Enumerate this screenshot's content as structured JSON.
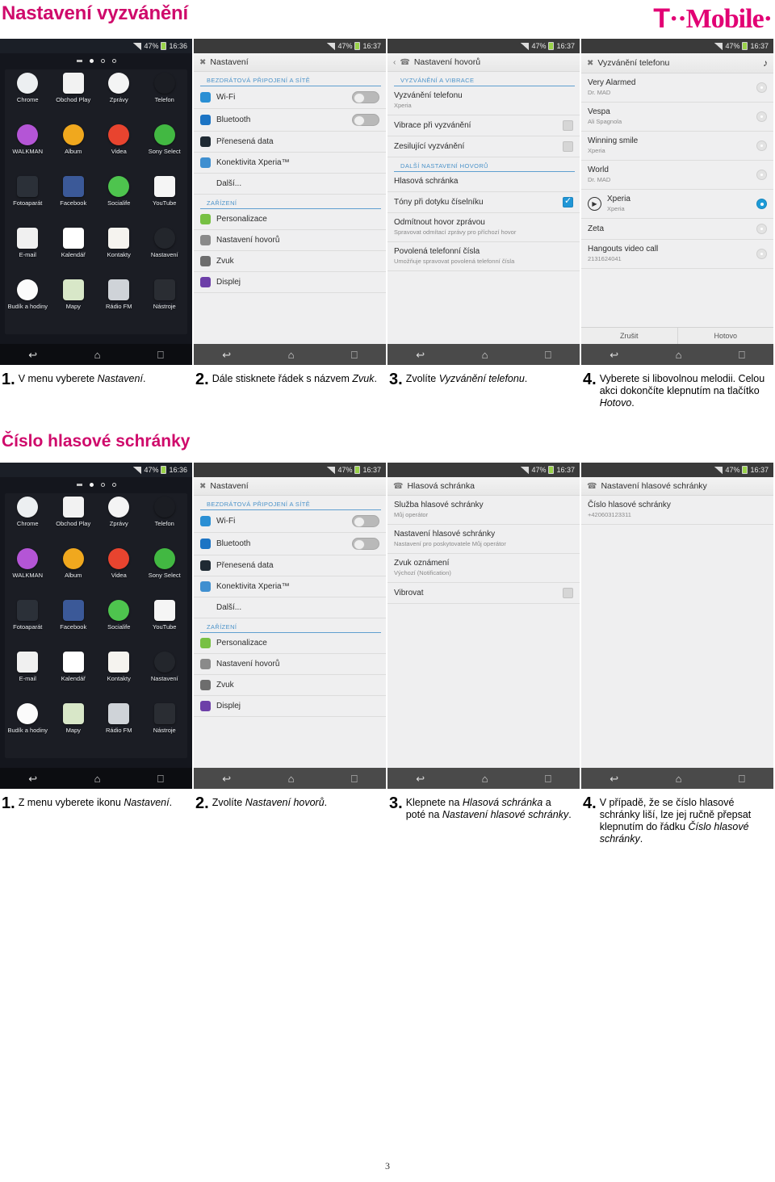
{
  "document": {
    "title": "Nastavení vyzvánění",
    "brand": "T-Mobile",
    "brand_t": "T",
    "brand_dots": "··",
    "brand_word": "Mobile",
    "brand_trailing_dot": "·",
    "page_number": "3",
    "section2_title": "Číslo hlasové schránky"
  },
  "statusbar": {
    "battery_pct": "47%",
    "time_1636": "16:36",
    "time_1637": "16:37"
  },
  "navbar": {
    "back": "back-icon",
    "home": "home-icon",
    "recents": "recents-icon"
  },
  "appdrawer": {
    "apps": [
      {
        "label": "Chrome",
        "color": "#eceff1"
      },
      {
        "label": "Obchod Play",
        "color": "#f2f2f2"
      },
      {
        "label": "Zprávy",
        "color": "#f4f4f4"
      },
      {
        "label": "Telefon",
        "color": "#1b1d23"
      },
      {
        "label": "WALKMAN",
        "color": "#b455d6"
      },
      {
        "label": "Album",
        "color": "#f0a81e"
      },
      {
        "label": "Videa",
        "color": "#e8442f"
      },
      {
        "label": "Sony Select",
        "color": "#42b842"
      },
      {
        "label": "Fotoaparát",
        "color": "#2b3038"
      },
      {
        "label": "Facebook",
        "color": "#3b5998"
      },
      {
        "label": "Socialife",
        "color": "#4ec44e"
      },
      {
        "label": "YouTube",
        "color": "#f5f5f5"
      },
      {
        "label": "E-mail",
        "color": "#f0f0f0"
      },
      {
        "label": "Kalendář",
        "color": "#ffffff"
      },
      {
        "label": "Kontakty",
        "color": "#f5f3ef"
      },
      {
        "label": "Nastavení",
        "color": "#23262c"
      },
      {
        "label": "Budík a hodiny",
        "color": "#fbfbfb"
      },
      {
        "label": "Mapy",
        "color": "#d8e7c8"
      },
      {
        "label": "Rádio FM",
        "color": "#cfd3d8"
      },
      {
        "label": "Nástroje",
        "color": "#2a2d33"
      }
    ]
  },
  "settings_screen": {
    "title": "Nastavení",
    "section_wireless": "BEZDRÁTOVÁ PŘIPOJENÍ A SÍTĚ",
    "section_device": "ZAŘÍZENÍ",
    "rows": [
      {
        "label": "Wi-Fi",
        "control": "toggle",
        "icon_color": "#2a8fd4"
      },
      {
        "label": "Bluetooth",
        "control": "toggle",
        "icon_color": "#1c74c4"
      },
      {
        "label": "Přenesená data",
        "control": "none",
        "icon_color": "#1f2a33"
      },
      {
        "label": "Konektivita Xperia™",
        "control": "none",
        "icon_color": "#3f8fd0"
      },
      {
        "label": "Další...",
        "control": "none",
        "icon_color": "transparent"
      }
    ],
    "rows2": [
      {
        "label": "Personalizace",
        "control": "none",
        "icon_color": "#77c043"
      },
      {
        "label": "Nastavení hovorů",
        "control": "none",
        "icon_color": "#8a8a8a"
      },
      {
        "label": "Zvuk",
        "control": "none",
        "icon_color": "#6d6d6d"
      },
      {
        "label": "Displej",
        "control": "none",
        "icon_color": "#6d3fa8"
      }
    ]
  },
  "call_settings_screen": {
    "title": "Nastavení hovorů",
    "section_ring": "VYZVÁNĚNÍ A VIBRACE",
    "section_more": "DALŠÍ NASTAVENÍ HOVORŮ",
    "rows_ring": [
      {
        "label": "Vyzvánění telefonu",
        "sub": "Xperia",
        "control": "none"
      },
      {
        "label": "Vibrace při vyzvánění",
        "sub": "",
        "control": "checkbox-off"
      },
      {
        "label": "Zesilující vyzvánění",
        "sub": "",
        "control": "checkbox-off"
      }
    ],
    "rows_more": [
      {
        "label": "Hlasová schránka",
        "sub": "",
        "control": "none"
      },
      {
        "label": "Tóny při dotyku číselníku",
        "sub": "",
        "control": "checkbox-on"
      },
      {
        "label": "Odmítnout hovor zprávou",
        "sub": "Spravovat odmítací zprávy pro příchozí hovor",
        "control": "none"
      },
      {
        "label": "Povolená telefonní čísla",
        "sub": "Umožňuje spravovat povolená telefonní čísla",
        "control": "none"
      }
    ]
  },
  "ringtone_screen": {
    "title": "Vyzvánění telefonu",
    "music_icon": "music-note-icon",
    "items": [
      {
        "name": "Very Alarmed",
        "artist": "Dr. MAD",
        "selected": false,
        "has_play": false
      },
      {
        "name": "Vespa",
        "artist": "Ali Spagnola",
        "selected": false,
        "has_play": false
      },
      {
        "name": "Winning smile",
        "artist": "Xperia",
        "selected": false,
        "has_play": false
      },
      {
        "name": "World",
        "artist": "Dr. MAD",
        "selected": false,
        "has_play": false
      },
      {
        "name": "Xperia",
        "artist": "Xperia",
        "selected": true,
        "has_play": true
      },
      {
        "name": "Zeta",
        "artist": "",
        "selected": false,
        "has_play": false
      },
      {
        "name": "Hangouts video call",
        "artist": "2131624041",
        "selected": false,
        "has_play": false
      }
    ],
    "cancel": "Zrušit",
    "done": "Hotovo"
  },
  "voicemail_screen": {
    "title": "Hlasová schránka",
    "rows": [
      {
        "label": "Služba hlasové schránky",
        "sub": "Můj operátor",
        "control": "none"
      },
      {
        "label": "Nastavení hlasové schránky",
        "sub": "Nastavení pro poskytovatele Můj operátor",
        "control": "none"
      },
      {
        "label": "Zvuk oznámení",
        "sub": "Výchozí (Notification)",
        "control": "none"
      },
      {
        "label": "Vibrovat",
        "sub": "",
        "control": "checkbox-off"
      }
    ]
  },
  "voicemail_settings_screen": {
    "title": "Nastavení hlasové schránky",
    "rows": [
      {
        "label": "Číslo hlasové schránky",
        "sub": "+420603123311",
        "control": "none"
      }
    ]
  },
  "steps_ringtone": [
    {
      "num": "1.",
      "html": "V menu vyberete <i>Nastavení</i>."
    },
    {
      "num": "2.",
      "html": "Dále stisknete řádek s názvem <i>Zvuk</i>."
    },
    {
      "num": "3.",
      "html": "Zvolíte <i>Vyzvánění telefonu</i>."
    },
    {
      "num": "4.",
      "html": "Vyberete si libovolnou melodii. Celou akci dokončíte klepnutím na tlačítko <i>Hotovo</i>."
    }
  ],
  "steps_voicemail": [
    {
      "num": "1.",
      "html": "Z menu vyberete ikonu <i>Nastavení</i>."
    },
    {
      "num": "2.",
      "html": "Zvolíte <i>Nastavení hovorů</i>."
    },
    {
      "num": "3.",
      "html": "Klepnete na <i>Hlasová schránka</i> a poté na <i>Nastavení hlasové schránky</i>."
    },
    {
      "num": "4.",
      "html": "V případě, že se číslo hlasové schránky liší, lze jej ručně přepsat klepnutím do řádku <i>Číslo hlasové schránky</i>."
    }
  ]
}
